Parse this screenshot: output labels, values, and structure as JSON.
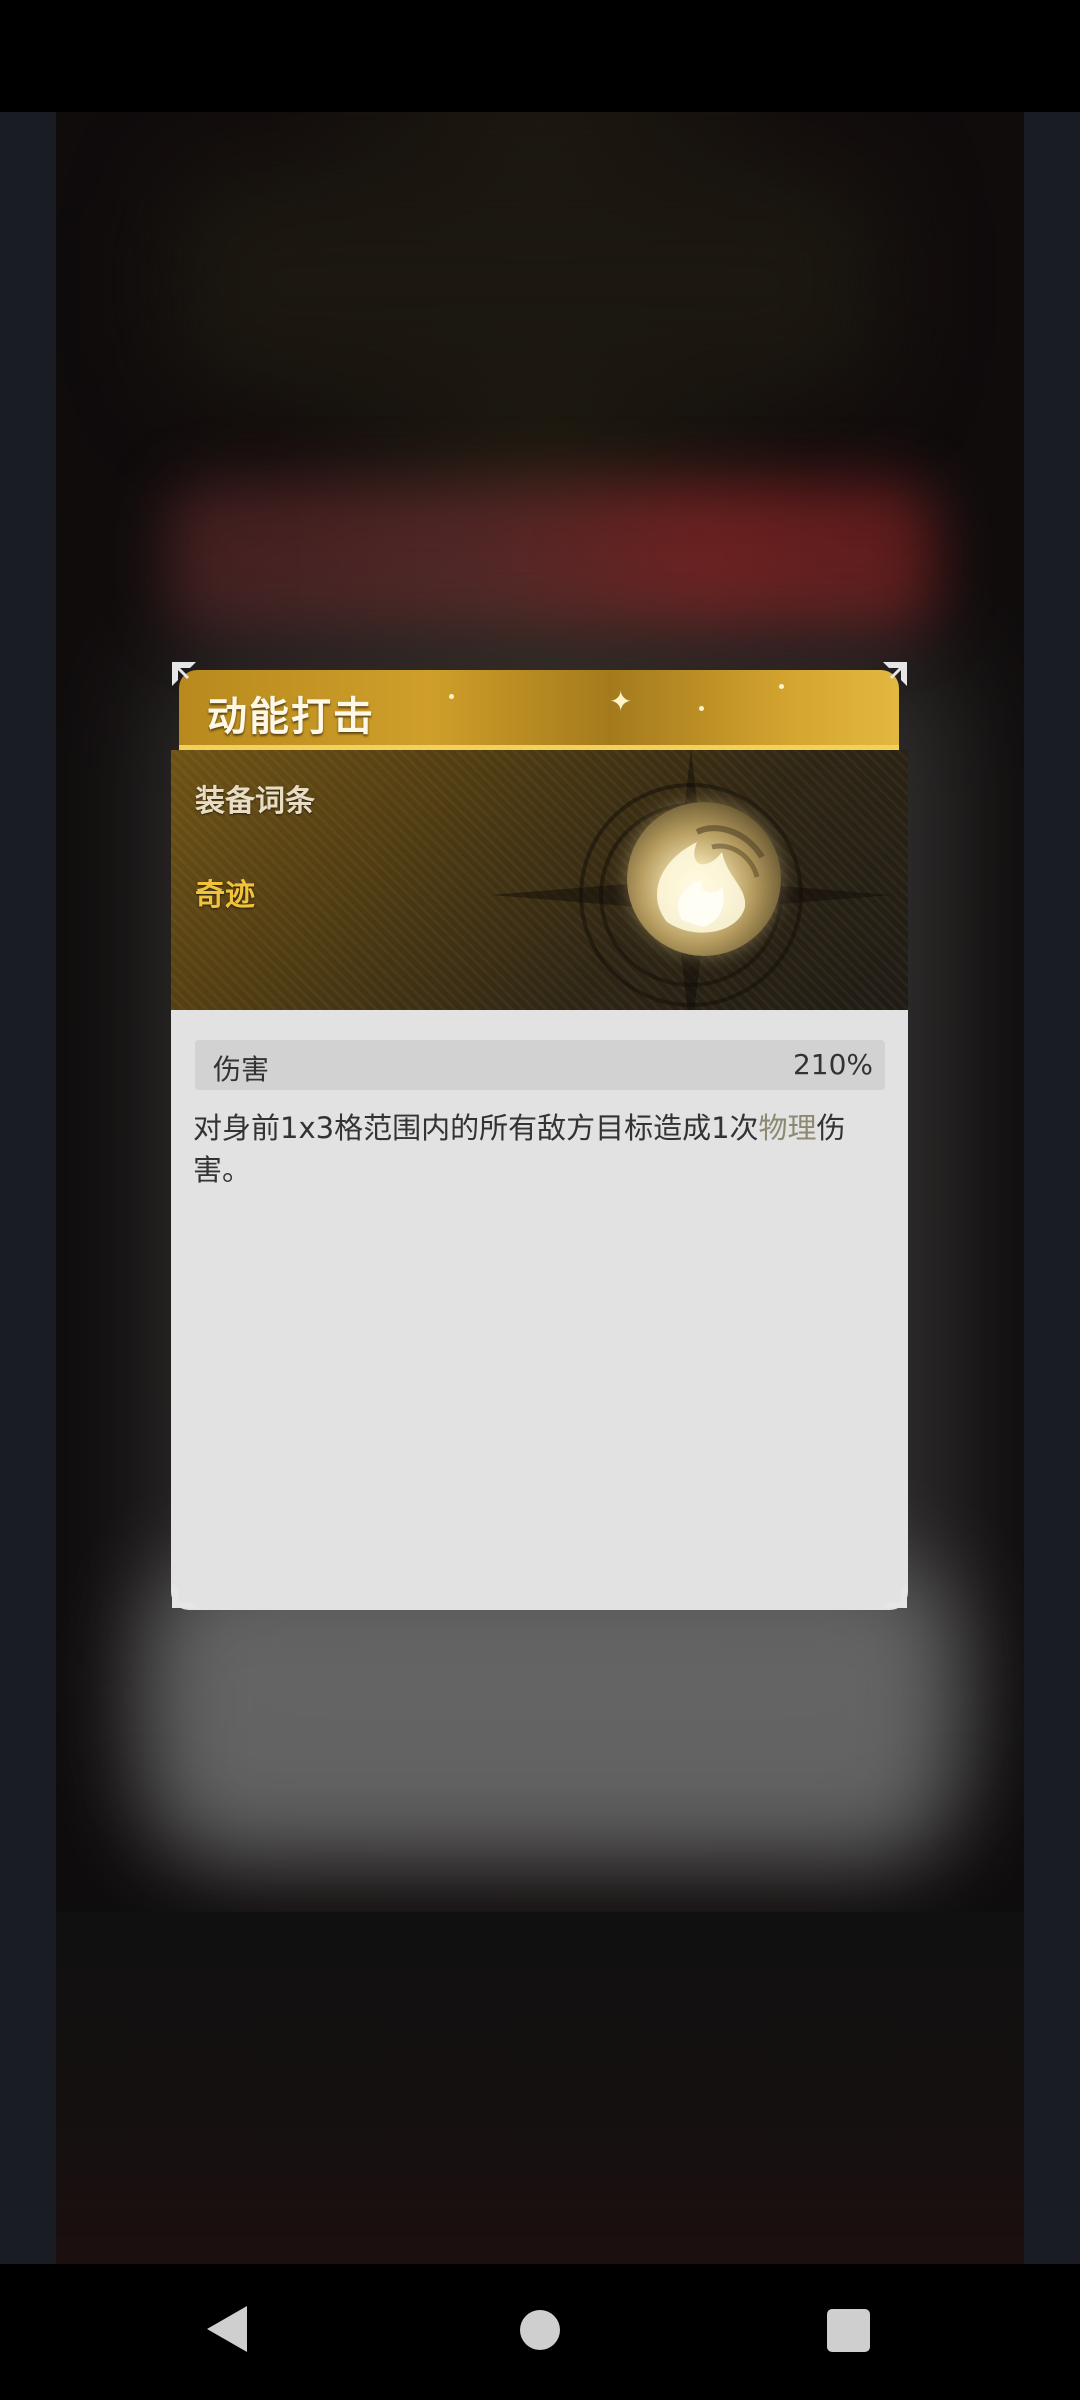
{
  "card": {
    "title": "动能打击",
    "category_label": "装备词条",
    "rarity_label": "奇迹",
    "stat": {
      "label": "伤害",
      "value": "210%"
    },
    "description": {
      "before": "对身前1x3格范围内的所有敌方目标造成1次",
      "highlight": "物理",
      "after": "伤害。"
    },
    "icon": "fire-meteor-icon"
  },
  "colors": {
    "header_gold": "#cf9f2a",
    "rarity_gold": "#f1c23c",
    "card_body": "#e2e2e2",
    "highlight_text": "#8d8872"
  },
  "nav": {
    "back_icon": "back-triangle-icon",
    "home_icon": "home-circle-icon",
    "recents_icon": "recents-square-icon"
  }
}
